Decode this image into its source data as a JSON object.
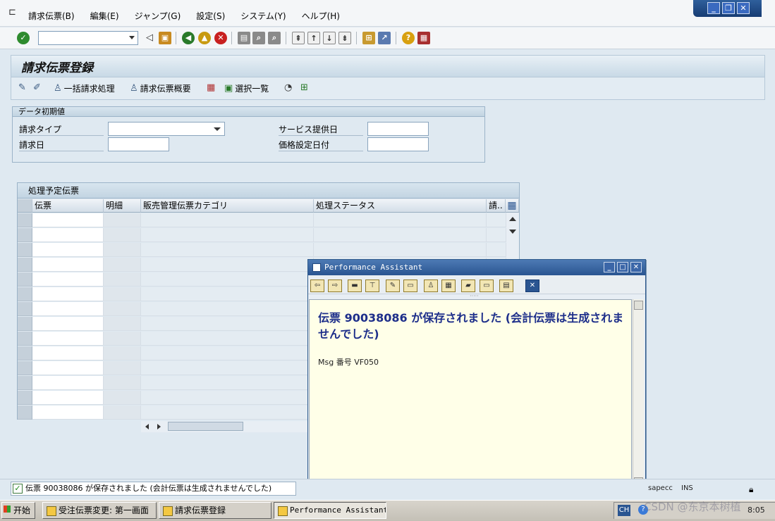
{
  "menubar": {
    "items": [
      "請求伝票(B)",
      "編集(E)",
      "ジャンプ(G)",
      "設定(S)",
      "システム(Y)",
      "ヘルプ(H)"
    ]
  },
  "window_controls": {
    "minimize": "_",
    "restore": "❐",
    "close": "✕"
  },
  "page": {
    "title": "請求伝票登録"
  },
  "app_toolbar": {
    "bulk_label": "一括請求処理",
    "overview_label": "請求伝票概要",
    "selection_label": "選択一覧"
  },
  "initial_values": {
    "title": "データ初期値",
    "billing_type_label": "請求タイプ",
    "billing_date_label": "請求日",
    "service_date_label": "サービス提供日",
    "pricing_date_label": "価格設定日付"
  },
  "docs_table": {
    "title": "処理予定伝票",
    "columns": [
      "伝票",
      "明細",
      "販売管理伝票カテゴリ",
      "処理ステータス",
      "請.."
    ]
  },
  "popup": {
    "title": "Performance Assistant",
    "message": "伝票  90038086 が保存されました (会計伝票は生成されませんでした)",
    "msg_number": "Msg 番号 VF050"
  },
  "statusbar": {
    "message": "伝票 90038086 が保存されました (会計伝票は生成されませんでした)",
    "server": "sapecc",
    "mode": "INS"
  },
  "taskbar": {
    "start": "开始",
    "tasks": [
      "受注伝票変更: 第一画面",
      "請求伝票登録",
      "Performance Assistant"
    ],
    "lang": "CH",
    "watermark": "CSDN @东京本树植",
    "time": "8:05"
  }
}
